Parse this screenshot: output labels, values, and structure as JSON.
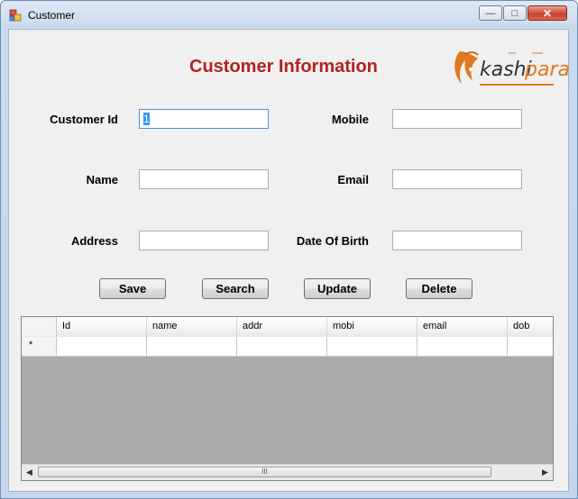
{
  "window": {
    "title": "Customer"
  },
  "form": {
    "heading": "Customer Information",
    "logo": {
      "text_part1": "kashi",
      "text_part2": "para",
      "icon": "lion-head-logo-icon",
      "brand_color": "#e07a1f"
    },
    "fields": {
      "customer_id": {
        "label": "Customer Id",
        "value": "1"
      },
      "mobile": {
        "label": "Mobile",
        "value": ""
      },
      "name": {
        "label": "Name",
        "value": ""
      },
      "email": {
        "label": "Email",
        "value": ""
      },
      "address": {
        "label": "Address",
        "value": ""
      },
      "dob": {
        "label": "Date Of Birth",
        "value": ""
      }
    },
    "buttons": {
      "save": "Save",
      "search": "Search",
      "update": "Update",
      "delete": "Delete"
    }
  },
  "grid": {
    "columns": [
      "Id",
      "name",
      "addr",
      "mobi",
      "email",
      "dob"
    ],
    "new_row_marker": "*",
    "scroll_thumb": "III"
  },
  "colors": {
    "heading": "#b22222",
    "selection": "#3399ff",
    "grid_background": "#ababab"
  }
}
